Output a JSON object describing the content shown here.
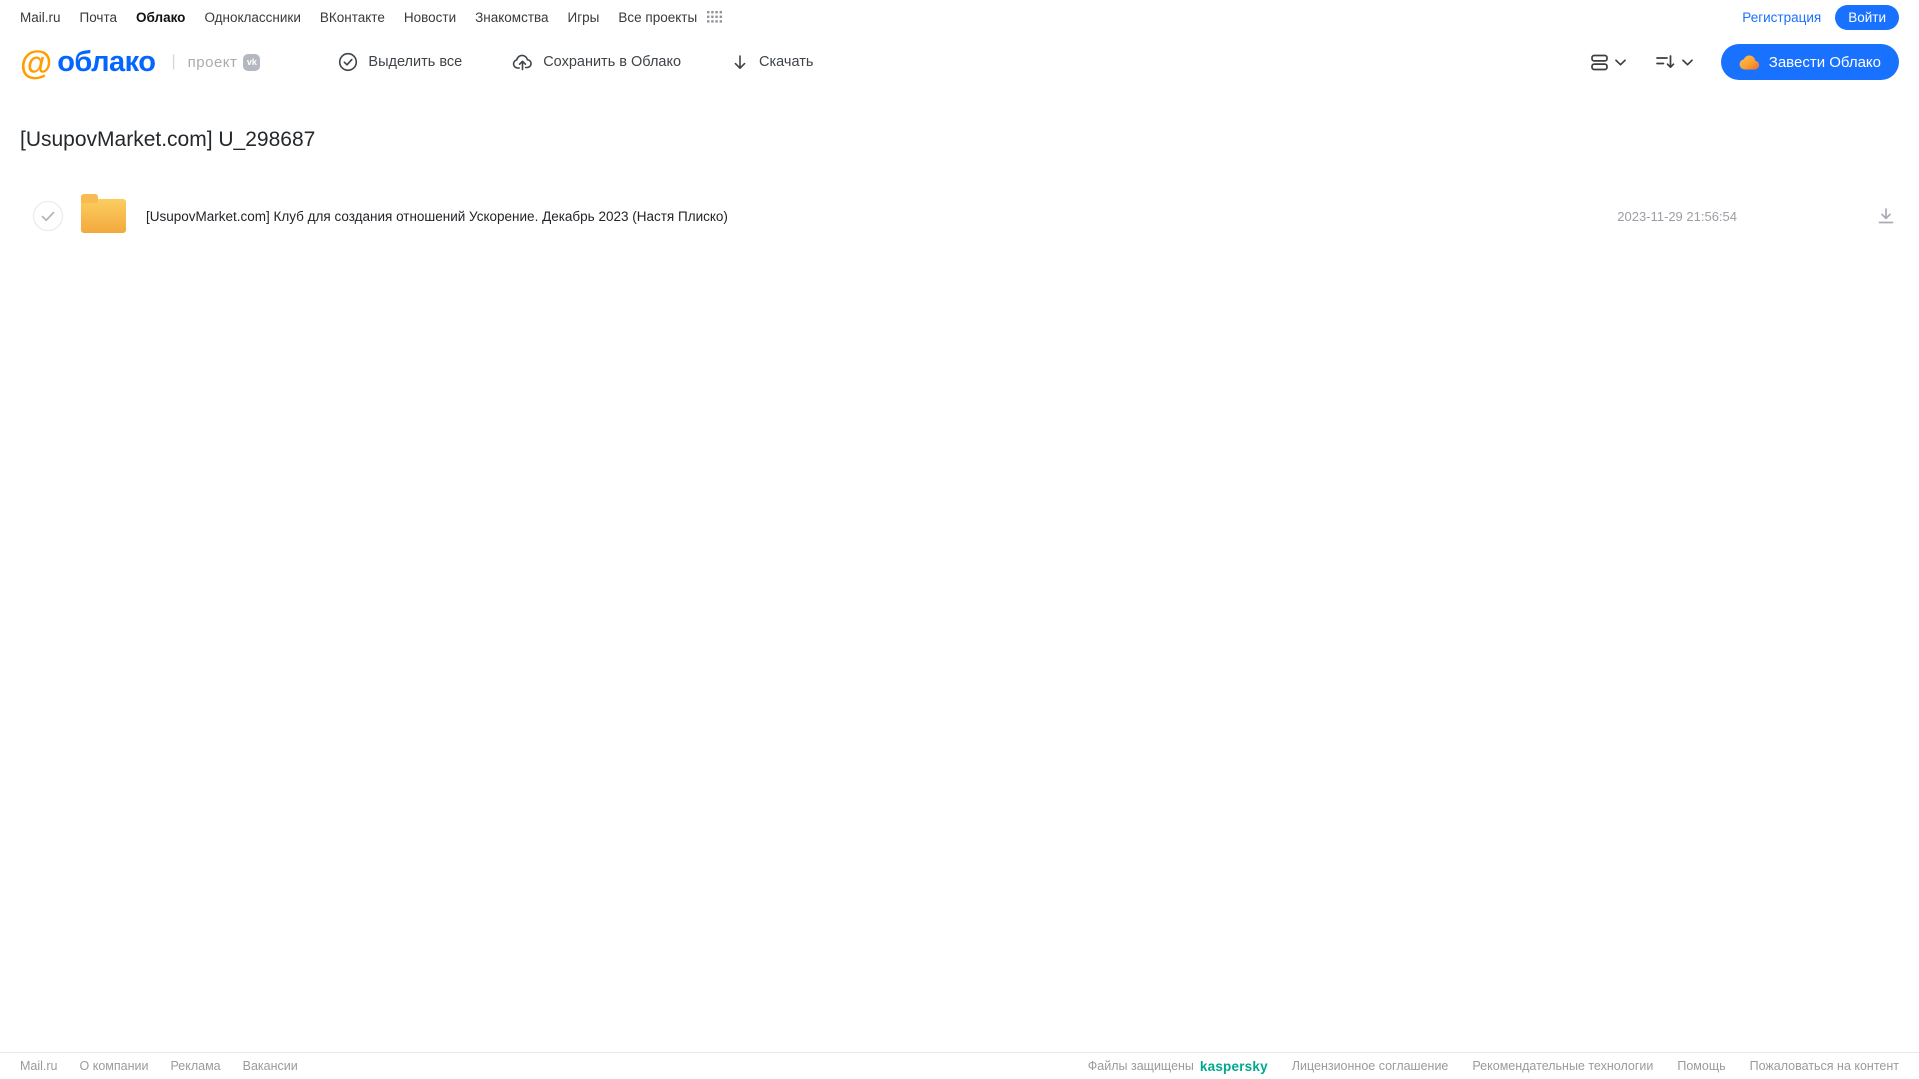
{
  "topnav": {
    "items": [
      "Mail.ru",
      "Почта",
      "Облако",
      "Одноклассники",
      "ВКонтакте",
      "Новости",
      "Знакомства",
      "Игры",
      "Все проекты"
    ],
    "registration_label": "Регистрация",
    "login_label": "Войти"
  },
  "header": {
    "logo_at": "@",
    "logo_text": "облако",
    "divider": "|",
    "project_label": "проект",
    "vk_badge": "vk",
    "actions": {
      "select_all": "Выделить все",
      "save_to_cloud": "Сохранить в Облако",
      "download": "Скачать"
    },
    "get_cloud_label": "Завести Облако"
  },
  "main": {
    "title": "[UsupovMarket.com] U_298687",
    "files": [
      {
        "name": "[UsupovMarket.com] Клуб для создания отношений Ускорение. Декабрь 2023 (Настя Плиско)",
        "date": "2023-11-29 21:56:54"
      }
    ]
  },
  "footer": {
    "left_links": [
      "Mail.ru",
      "О компании",
      "Реклама",
      "Вакансии"
    ],
    "protected_label": "Файлы защищены",
    "kaspersky_label": "kaspersky",
    "right_links": [
      "Лицензионное соглашение",
      "Рекомендательные технологии",
      "Помощь",
      "Пожаловаться на контент"
    ]
  },
  "colors": {
    "accent_blue": "#1971ff",
    "logo_orange": "#ff9e00",
    "logo_blue": "#0565ff",
    "folder_yellow": "#f7b948",
    "kaspersky_green": "#00a88e"
  }
}
